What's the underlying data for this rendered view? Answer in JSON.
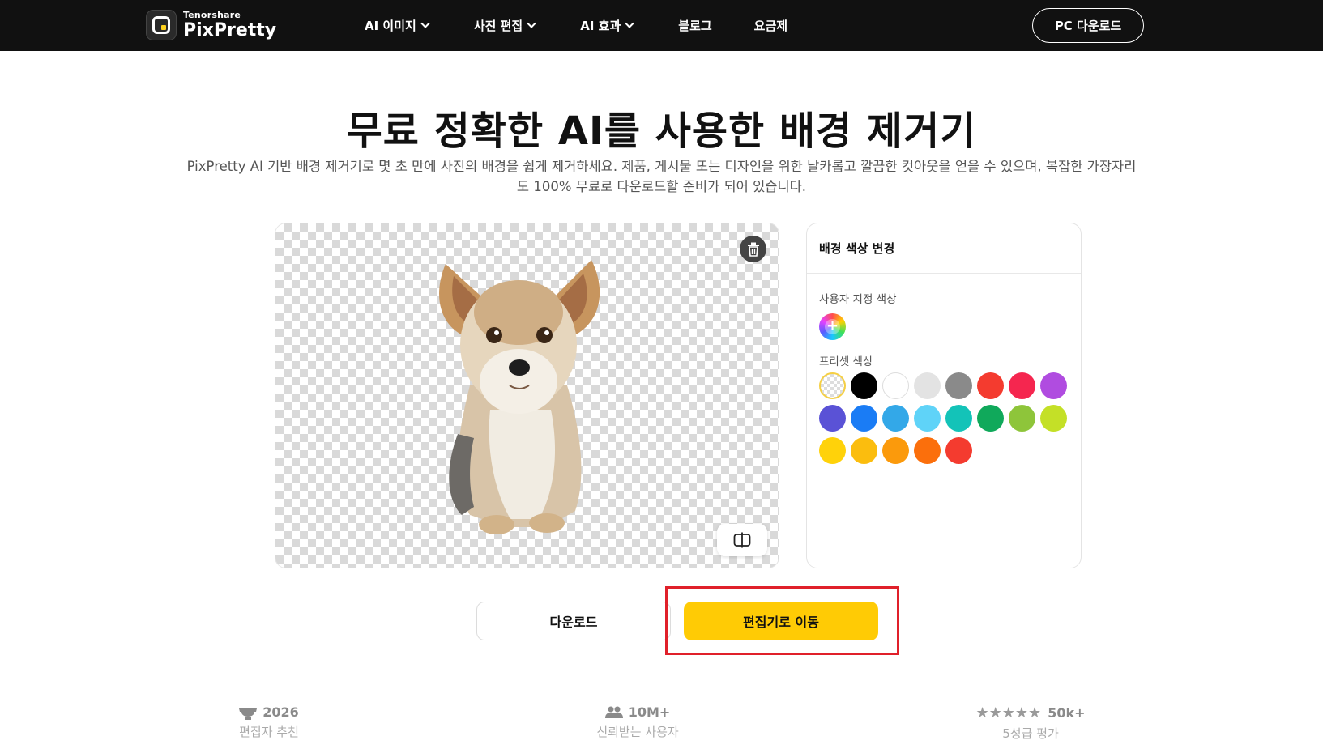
{
  "brand": {
    "company": "Tenorshare",
    "product": "PixPretty"
  },
  "nav": {
    "items": [
      {
        "label": "AI 이미지",
        "has_dropdown": true
      },
      {
        "label": "사진 편집",
        "has_dropdown": true
      },
      {
        "label": "AI 효과",
        "has_dropdown": true
      },
      {
        "label": "블로그",
        "has_dropdown": false
      },
      {
        "label": "요금제",
        "has_dropdown": false
      }
    ],
    "cta": "PC 다운로드"
  },
  "hero": {
    "title_highlight": "무료",
    "title_rest": " 정확한 AI를 사용한 배경 제거기",
    "subtitle_line1": "PixPretty AI 기반 배경 제거기로 몇 초 만에 사진의 배경을 쉽게 제거하세요. 제품, 게시물 또는 디자인을 위한 날카롭고 깔끔한 컷아웃을 얻을 수 있으며, 복잡한 가장자리",
    "subtitle_line2": "도 100% 무료로 다운로드할 준비가 되어 있습니다."
  },
  "preview": {
    "image_subject": "dog-cutout",
    "delete_icon": "trash-icon",
    "compare_icon": "compare-icon"
  },
  "panel": {
    "title": "배경 색상 변경",
    "custom_label": "사용자 지정 색상",
    "preset_label": "프리셋 색상",
    "presets": [
      "transparent",
      "#000000",
      "#ffffff",
      "#e3e3e3",
      "#8a8a8a",
      "#f43b2f",
      "#f5264f",
      "#b04ce0",
      "#5a52d6",
      "#1a7cf5",
      "#33a8e8",
      "#5fd3f8",
      "#13c3b8",
      "#10a95b",
      "#8ec53a",
      "#c4e027",
      "#ffd20a",
      "#fbbd0e",
      "#fb9a0c",
      "#fb6f0c",
      "#f43b2f"
    ]
  },
  "actions": {
    "download": "다운로드",
    "edit": "편집기로 이동"
  },
  "stats": [
    {
      "icon": "award-icon",
      "value": "2026",
      "label": "편집자 추천"
    },
    {
      "icon": "users-icon",
      "value": "10M+",
      "label": "신뢰받는 사용자"
    },
    {
      "icon": "stars-icon",
      "value": "50k+",
      "label": "5성급 평가",
      "stars": 5
    }
  ],
  "colors": {
    "nav_bg": "#111111",
    "accent": "#ffcb05",
    "highlight_box": "#e0202a"
  }
}
